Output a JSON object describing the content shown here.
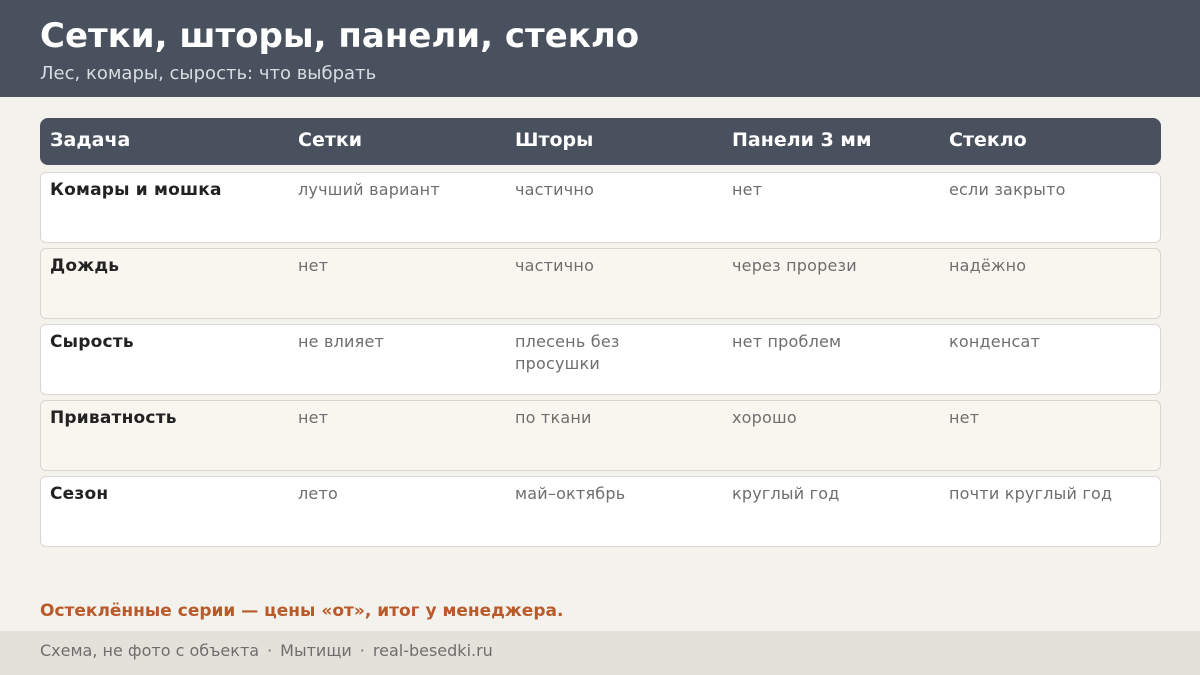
{
  "header": {
    "title": "Сетки, шторы, панели, стекло",
    "subtitle": "Лес, комары, сырость: что выбрать"
  },
  "table": {
    "columns": [
      "Задача",
      "Сетки",
      "Шторы",
      "Панели 3 мм",
      "Стекло"
    ],
    "rows": [
      {
        "task": "Комары и мошка",
        "cells": [
          "лучший вариант",
          "частично",
          "нет",
          "если закрыто"
        ]
      },
      {
        "task": "Дождь",
        "cells": [
          "нет",
          "частично",
          "через прорези",
          "надёжно"
        ]
      },
      {
        "task": "Сырость",
        "cells": [
          "не влияет",
          "плесень без просушки",
          "нет проблем",
          "конденсат"
        ]
      },
      {
        "task": "Приватность",
        "cells": [
          "нет",
          "по ткани",
          "хорошо",
          "нет"
        ]
      },
      {
        "task": "Сезон",
        "cells": [
          "лето",
          "май–октябрь",
          "круглый год",
          "почти круглый год"
        ]
      }
    ]
  },
  "note": "Остеклённые серии — цены «от», итог у менеджера.",
  "footer": {
    "items": [
      "Схема, не фото с объекта",
      "Мытищи",
      "real-besedki.ru"
    ],
    "separator": "·"
  },
  "colors": {
    "header_bg": "#48515d",
    "accent": "#b85a2a",
    "page_bg": "#f4f2ed"
  }
}
